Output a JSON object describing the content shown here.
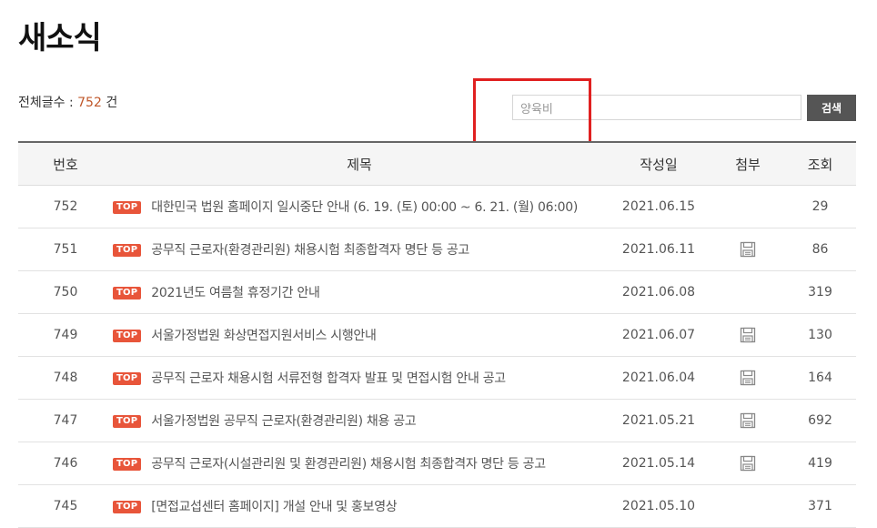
{
  "page": {
    "title": "새소식"
  },
  "summary": {
    "label": "전체글수 : ",
    "count": "752",
    "unit": " 건"
  },
  "search": {
    "value": "양육비",
    "button_label": "검색"
  },
  "table": {
    "headers": [
      "번호",
      "제목",
      "작성일",
      "첨부",
      "조회"
    ],
    "rows": [
      {
        "no": "752",
        "badge": "TOP",
        "title": "대한민국 법원 홈페이지 일시중단 안내 (6. 19. (토) 00:00 ~ 6. 21. (월) 06:00)",
        "date": "2021.06.15",
        "attachment": false,
        "views": "29"
      },
      {
        "no": "751",
        "badge": "TOP",
        "title": "공무직 근로자(환경관리원) 채용시험 최종합격자 명단 등 공고",
        "date": "2021.06.11",
        "attachment": true,
        "views": "86"
      },
      {
        "no": "750",
        "badge": "TOP",
        "title": "2021년도 여름철 휴정기간 안내",
        "date": "2021.06.08",
        "attachment": false,
        "views": "319"
      },
      {
        "no": "749",
        "badge": "TOP",
        "title": "서울가정법원 화상면접지원서비스 시행안내",
        "date": "2021.06.07",
        "attachment": true,
        "views": "130"
      },
      {
        "no": "748",
        "badge": "TOP",
        "title": "공무직 근로자 채용시험 서류전형 합격자 발표 및 면접시험 안내 공고",
        "date": "2021.06.04",
        "attachment": true,
        "views": "164"
      },
      {
        "no": "747",
        "badge": "TOP",
        "title": "서울가정법원 공무직 근로자(환경관리원) 채용 공고",
        "date": "2021.05.21",
        "attachment": true,
        "views": "692"
      },
      {
        "no": "746",
        "badge": "TOP",
        "title": "공무직 근로자(시설관리원 및 환경관리원) 채용시험 최종합격자 명단 등 공고",
        "date": "2021.05.14",
        "attachment": true,
        "views": "419"
      },
      {
        "no": "745",
        "badge": "TOP",
        "title": "[면접교섭센터 홈페이지] 개설 안내 및 홍보영상",
        "date": "2021.05.10",
        "attachment": false,
        "views": "371"
      }
    ]
  },
  "colors": {
    "badge": "#e8553a",
    "count": "#c0582b",
    "highlight": "#e02020",
    "button": "#555555"
  },
  "icons": {
    "attachment": "save-disk-icon"
  }
}
